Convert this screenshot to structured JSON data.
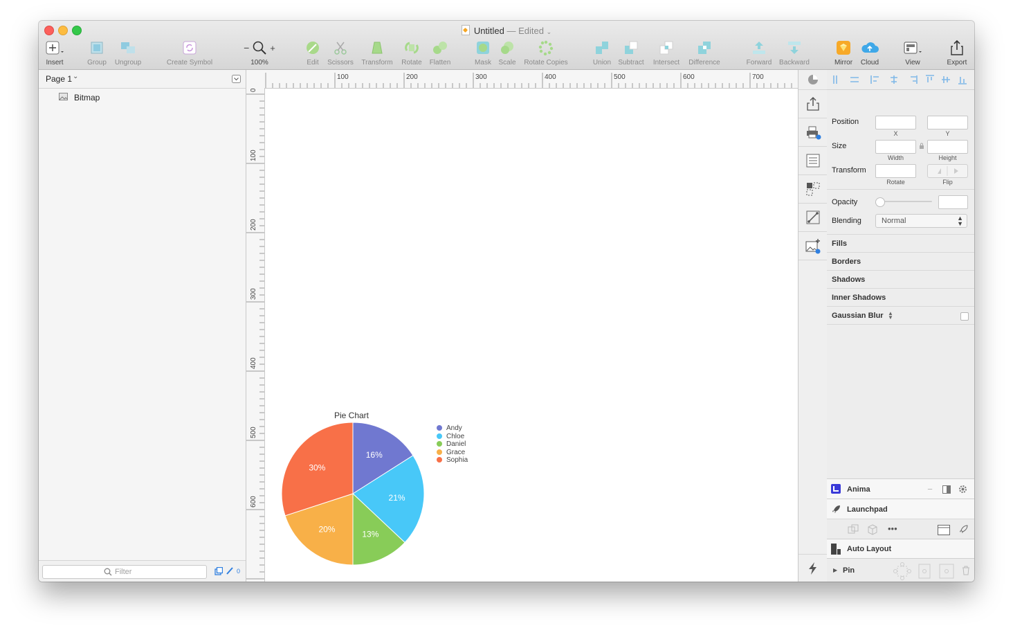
{
  "window": {
    "title": "Untitled",
    "title_suffix": "— Edited"
  },
  "toolbar": {
    "insert": "Insert",
    "group": "Group",
    "ungroup": "Ungroup",
    "create_symbol": "Create Symbol",
    "zoom_minus": "−",
    "zoom_plus": "+",
    "zoom_level": "100%",
    "edit": "Edit",
    "scissors": "Scissors",
    "transform": "Transform",
    "rotate": "Rotate",
    "flatten": "Flatten",
    "mask": "Mask",
    "scale": "Scale",
    "rotate_copies": "Rotate Copies",
    "union": "Union",
    "subtract": "Subtract",
    "intersect": "Intersect",
    "difference": "Difference",
    "forward": "Forward",
    "backward": "Backward",
    "mirror": "Mirror",
    "cloud": "Cloud",
    "view": "View",
    "export": "Export"
  },
  "sidebar": {
    "page_selector": "Page 1",
    "layers": [
      {
        "name": "Bitmap"
      }
    ],
    "filter_placeholder": "Filter",
    "filter_count": "0"
  },
  "rulers": {
    "top_labels": [
      "100",
      "200",
      "300",
      "400",
      "500",
      "600",
      "700"
    ],
    "left_labels": [
      "0",
      "100",
      "200",
      "300",
      "400",
      "500",
      "600"
    ]
  },
  "inspector": {
    "position_label": "Position",
    "x_label": "X",
    "y_label": "Y",
    "size_label": "Size",
    "width_label": "Width",
    "height_label": "Height",
    "transform_label": "Transform",
    "rotate_label": "Rotate",
    "flip_label": "Flip",
    "opacity_label": "Opacity",
    "blending_label": "Blending",
    "blending_value": "Normal",
    "sections": [
      "Fills",
      "Borders",
      "Shadows",
      "Inner Shadows",
      "Gaussian Blur"
    ]
  },
  "plugins": {
    "anima": "Anima",
    "launchpad": "Launchpad",
    "auto_layout": "Auto Layout",
    "pin": "Pin"
  },
  "chart_data": {
    "type": "pie",
    "title": "Pie Chart",
    "categories": [
      "Andy",
      "Chloe",
      "Daniel",
      "Grace",
      "Sophia"
    ],
    "values": [
      16,
      21,
      13,
      20,
      30
    ],
    "labels": [
      "16%",
      "21%",
      "13%",
      "20%",
      "30%"
    ],
    "colors": [
      "#7078d0",
      "#48c8f8",
      "#88cc58",
      "#f8b048",
      "#f87048"
    ],
    "legend_position": "right"
  }
}
